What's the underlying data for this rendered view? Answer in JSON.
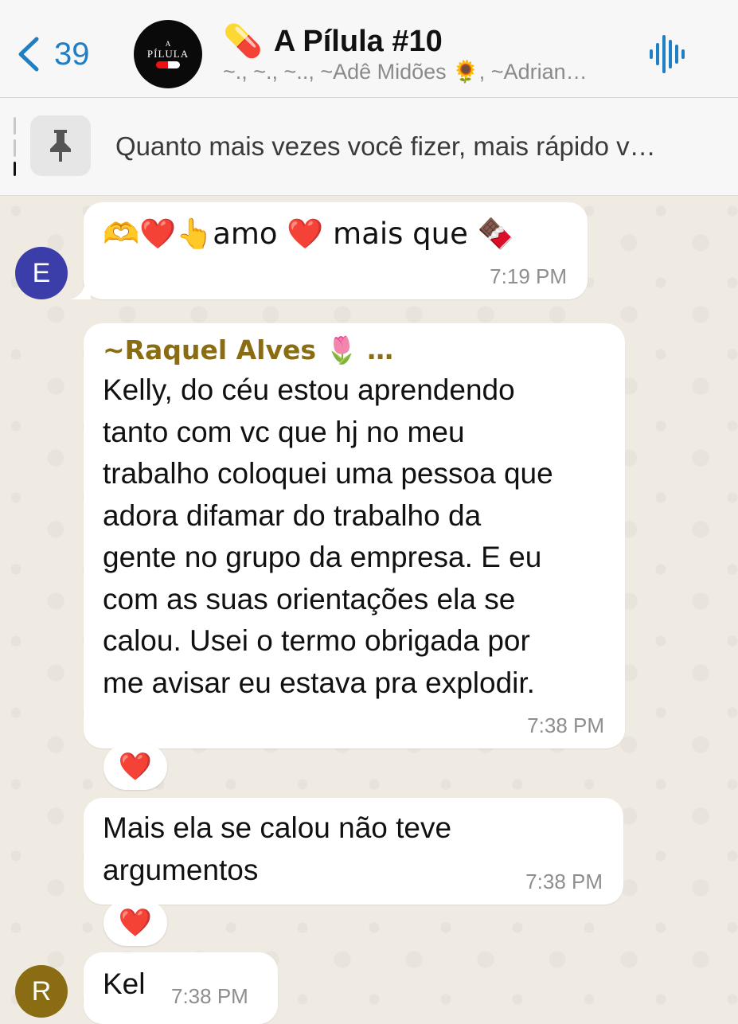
{
  "header": {
    "back_count": "39",
    "group_avatar": {
      "top_text": "A",
      "name": "PÍLULA"
    },
    "title_emoji": "💊",
    "title": "A Pílula #10",
    "subtitle": "~., ~., ~.., ~Adê Midões 🌻, ~Adrian…"
  },
  "pinned": {
    "text": "Quanto mais vezes você fizer, mais rápido v…"
  },
  "messages": [
    {
      "avatar_letter": "E",
      "text": "🫶❤️👆amo ❤️ mais que 🍫",
      "time": "7:19 PM"
    },
    {
      "sender": "~Raquel Alves 🌷 …",
      "lines": [
        "Kelly, do céu  estou aprendendo",
        "tanto com vc que hj no meu",
        "trabalho  coloquei uma pessoa que",
        "adora difamar do trabalho  da",
        "gente no grupo da empresa.  E eu",
        "com as suas orientações  ela se",
        "calou. Usei o termo obrigada  por",
        "me avisar eu estava pra explodir."
      ],
      "time": "7:38 PM",
      "reaction": "❤️"
    },
    {
      "lines": [
        "Mais ela se calou não teve",
        "argumentos"
      ],
      "time": "7:38 PM",
      "reaction": "❤️"
    },
    {
      "avatar_letter": "R",
      "text": "Kel",
      "time": "7:38 PM"
    }
  ],
  "colors": {
    "accent": "#1f7fc4",
    "avatar_e": "#3b3ea8",
    "avatar_r": "#8a6d12",
    "sender_name": "#8a6d12",
    "wallpaper": "#efeae2"
  },
  "icons": [
    "back-chevron-icon",
    "audio-waveform-icon",
    "pin-icon"
  ]
}
